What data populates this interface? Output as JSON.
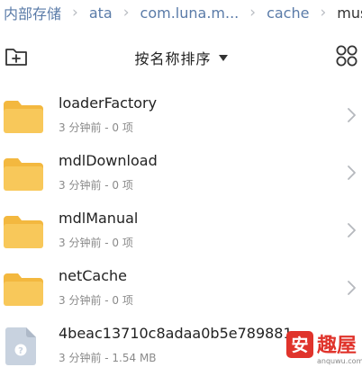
{
  "breadcrumb": {
    "items": [
      "内部存储",
      "ata",
      "com.luna.m...",
      "cache",
      "music"
    ]
  },
  "toolbar": {
    "sort_label": "按名称排序"
  },
  "files": [
    {
      "name": "loaderFactory",
      "meta": "3 分钟前 - 0 项",
      "kind": "folder"
    },
    {
      "name": "mdlDownload",
      "meta": "3 分钟前 - 0 项",
      "kind": "folder"
    },
    {
      "name": "mdlManual",
      "meta": "3 分钟前 - 0 项",
      "kind": "folder"
    },
    {
      "name": "netCache",
      "meta": "3 分钟前 - 0 项",
      "kind": "folder"
    },
    {
      "name": "4beac13710c8adaa0b5e789881",
      "meta": "3 分钟前 - 1.54 MB",
      "kind": "file"
    }
  ],
  "watermark": {
    "brand": "安趣屋",
    "domain": "anquwu.com"
  },
  "colors": {
    "folder": "#f8c85a",
    "folder_tab": "#f3b83f",
    "breadcrumb_link": "#5a7ba8",
    "file_icon": "#c8d2df",
    "watermark_red": "#e0332b"
  }
}
